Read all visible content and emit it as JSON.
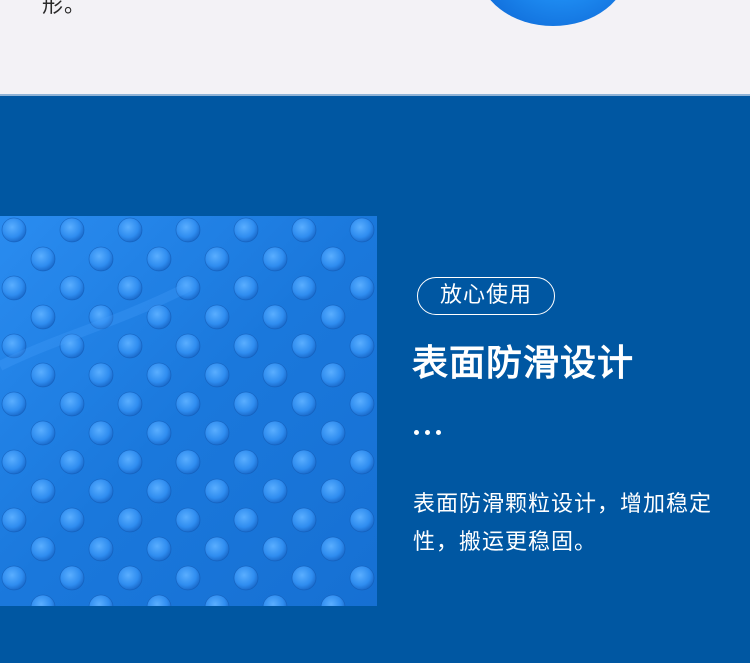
{
  "top": {
    "text": "形。"
  },
  "feature": {
    "badge": "放心使用",
    "heading": "表面防滑设计",
    "description": "表面防滑颗粒设计，增加稳定性，搬运更稳固。"
  },
  "colors": {
    "background_top": "#f3f2f6",
    "background_main": "#0057a2",
    "texture_base": "#1e7fe0",
    "text": "#ffffff"
  },
  "icons": {
    "dots": "ellipsis-dots-icon"
  }
}
